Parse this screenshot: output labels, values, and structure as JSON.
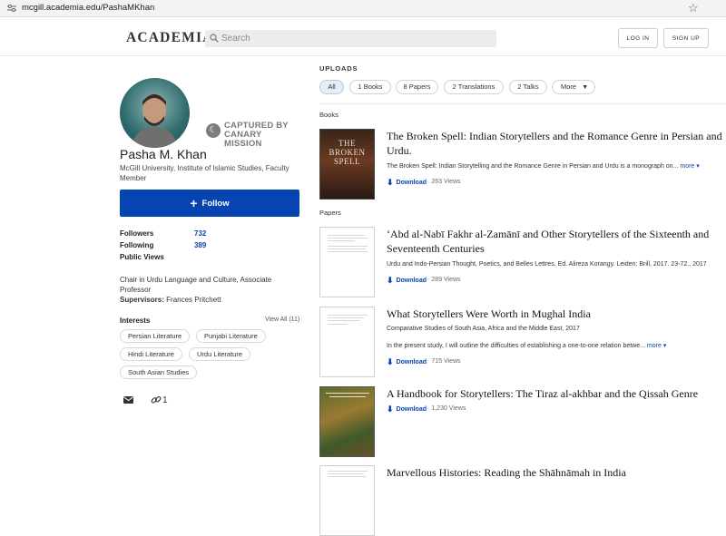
{
  "browser": {
    "url": "mcgill.academia.edu/PashaMKhan"
  },
  "header": {
    "logo": "ACADEMIA",
    "search_placeholder": "Search",
    "login": "LOG IN",
    "signup": "SIGN UP"
  },
  "profile": {
    "canary_line1": "CAPTURED BY",
    "canary_line2": "CANARY MISSION",
    "name": "Pasha M. Khan",
    "affiliation": "McGill University, Institute of Islamic Studies, Faculty Member",
    "follow": "Follow",
    "stats": [
      {
        "label": "Followers",
        "value": "732"
      },
      {
        "label": "Following",
        "value": "389"
      },
      {
        "label": "Public Views",
        "value": ""
      }
    ],
    "bio": "Chair in Urdu Language and Culture, Associate Professor",
    "supervisors_label": "Supervisors:",
    "supervisors": "Frances Pritchett",
    "interests_title": "Interests",
    "view_all": "View All (11)",
    "interests": [
      "Persian Literature",
      "Punjabi Literature",
      "Hindi Literature",
      "Urdu Literature",
      "South Asian Studies"
    ],
    "link_count": "1"
  },
  "uploads": {
    "heading": "UPLOADS",
    "tabs": [
      "All",
      "1 Books",
      "8 Papers",
      "2 Translations",
      "2 Talks",
      "More"
    ],
    "sections": {
      "books": "Books",
      "papers": "Papers"
    },
    "download": "Download",
    "more": "more",
    "items": [
      {
        "title": "The Broken Spell: Indian Storytellers and the Romance Genre in Persian and Urdu.",
        "desc": "The Broken Spell: Indian Storytelling and the Romance Genre in Persian and Urdu is a monograph on...",
        "views": "263 Views",
        "cover": "THE BROKEN SPELL"
      },
      {
        "title": "‘Abd al-Nabī Fakhr al-Zamānī and Other Storytellers of the Sixteenth and Seventeenth Centuries",
        "desc": "Urdu and Indo-Persian Thought, Poetics, and Belles Lettres. Ed. Alireza Korangy. Leiden: Brill, 2017. 23-72., 2017",
        "views": "289 Views"
      },
      {
        "title": "What Storytellers Were Worth in Mughal India",
        "desc": "Comparative Studies of South Asia, Africa and the Middle East, 2017",
        "desc2": "In the present study, I will outline the difficulties of establishing a one-to-one relation betwe...",
        "views": "715 Views"
      },
      {
        "title": "A Handbook for Storytellers: The Tiraz al-akhbar and the Qissah Genre",
        "views": "1,230 Views"
      },
      {
        "title": "Marvellous Histories: Reading the Shāhnāmah in India"
      }
    ]
  }
}
